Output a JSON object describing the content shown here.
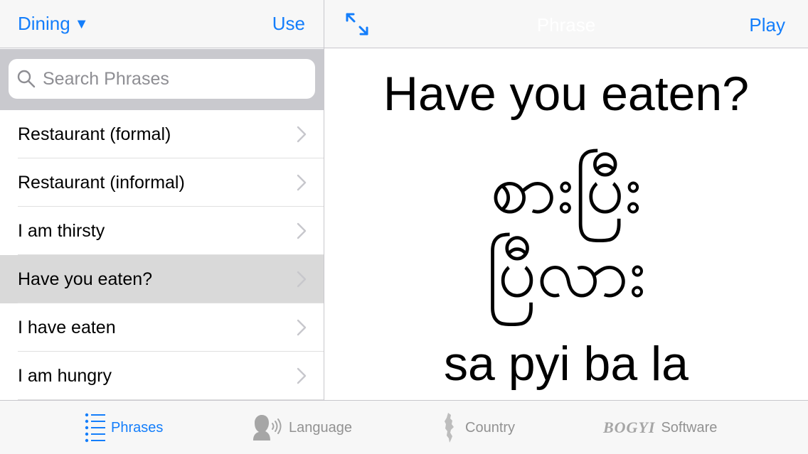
{
  "left_nav": {
    "category_label": "Dining",
    "use_label": "Use"
  },
  "right_nav": {
    "title": "Phrase",
    "play_label": "Play"
  },
  "search": {
    "placeholder": "Search Phrases",
    "value": ""
  },
  "phrases": [
    {
      "label": "Restaurant (formal)",
      "selected": false
    },
    {
      "label": "Restaurant (informal)",
      "selected": false
    },
    {
      "label": "I am thirsty",
      "selected": false
    },
    {
      "label": "Have you eaten?",
      "selected": true
    },
    {
      "label": "I have eaten",
      "selected": false
    },
    {
      "label": "I am hungry",
      "selected": false
    }
  ],
  "detail": {
    "english": "Have you eaten?",
    "burmese_line1": "စားပြီး",
    "burmese_line2": "ပြီလား",
    "romanized": "sa pyi ba la"
  },
  "tabs": [
    {
      "label": "Phrases",
      "active": true
    },
    {
      "label": "Language",
      "active": false
    },
    {
      "label": "Country",
      "active": false
    },
    {
      "label": "Software",
      "active": false,
      "logo_text": "BOGYI"
    }
  ],
  "colors": {
    "accent": "#147efb",
    "inactive": "#929292",
    "bar_bg": "#f7f7f7",
    "selected_row": "#d9d9d9"
  }
}
